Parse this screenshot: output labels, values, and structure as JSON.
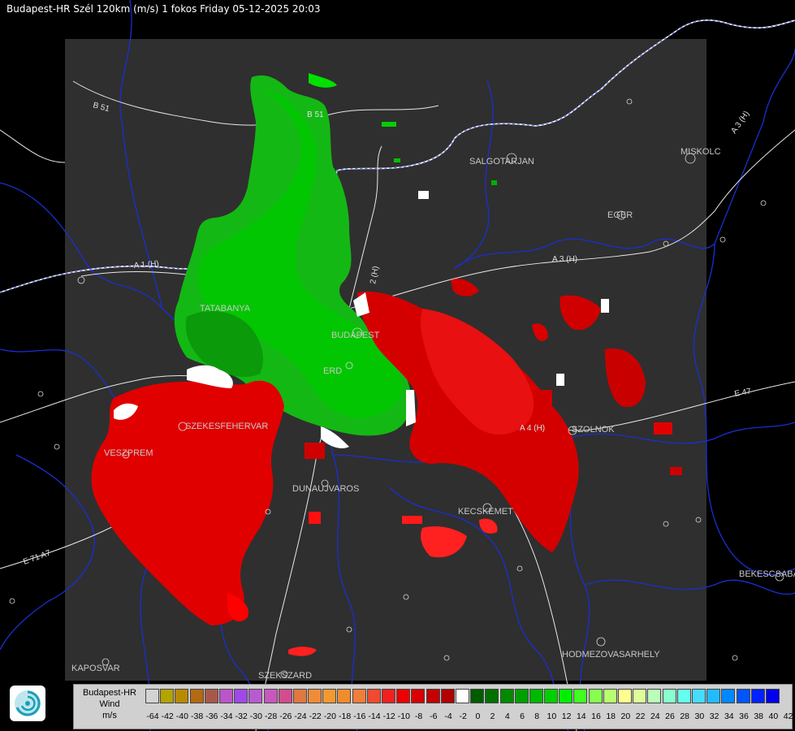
{
  "header": {
    "title": "Budapest-HR Szél 120km (m/s) 1 fokos Friday 05-12-2025 20:03"
  },
  "cities": [
    {
      "id": "salgotarjan",
      "label": "SALGOTARJAN"
    },
    {
      "id": "miskolc",
      "label": "MISKOLC"
    },
    {
      "id": "eger",
      "label": "EGER"
    },
    {
      "id": "tatabanya",
      "label": "TATABANYA"
    },
    {
      "id": "budapest",
      "label": "BUDAPEST"
    },
    {
      "id": "erd",
      "label": "ERD"
    },
    {
      "id": "szekesfehervar",
      "label": "SZEKESFEHERVAR"
    },
    {
      "id": "veszprem",
      "label": "VESZPREM"
    },
    {
      "id": "dunaujvaros",
      "label": "DUNAUJVAROS"
    },
    {
      "id": "kecskemet",
      "label": "KECSKEMET"
    },
    {
      "id": "szolnok",
      "label": "SZOLNOK"
    },
    {
      "id": "bekescsaba",
      "label": "BEKESCSABA"
    },
    {
      "id": "hodmezovasarhely",
      "label": "HODMEZOVASARHELY"
    },
    {
      "id": "kaposvar",
      "label": "KAPOSVAR"
    },
    {
      "id": "szekszard",
      "label": "SZEKSZARD"
    }
  ],
  "roads": [
    {
      "id": "b51-top",
      "label": "B 51"
    },
    {
      "id": "b51-mid",
      "label": "B 51"
    },
    {
      "id": "a1",
      "label": "A 1 (H)"
    },
    {
      "id": "a2",
      "label": "2 (H)"
    },
    {
      "id": "a3",
      "label": "A 3 (H)"
    },
    {
      "id": "a3-ne",
      "label": "A 3 (H)"
    },
    {
      "id": "a4",
      "label": "A 4 (H)"
    },
    {
      "id": "e71",
      "label": "E 71 A7"
    },
    {
      "id": "e47",
      "label": "E 47"
    }
  ],
  "legend": {
    "title_lines": [
      "Budapest-HR",
      "Wind",
      "m/s"
    ],
    "ticks": [
      "-64",
      "-42",
      "-40",
      "-38",
      "-36",
      "-34",
      "-32",
      "-30",
      "-28",
      "-26",
      "-24",
      "-22",
      "-20",
      "-18",
      "-16",
      "-14",
      "-12",
      "-10",
      "-8",
      "-6",
      "-4",
      "-2",
      "0",
      "2",
      "4",
      "6",
      "8",
      "10",
      "12",
      "14",
      "16",
      "18",
      "20",
      "22",
      "24",
      "26",
      "28",
      "30",
      "32",
      "34",
      "36",
      "38",
      "40",
      "42"
    ],
    "colors": [
      "#d3d3d3",
      "#b3a400",
      "#b88a00",
      "#b56a12",
      "#a8584a",
      "#bb55c8",
      "#a048e8",
      "#b85ad0",
      "#c658be",
      "#d24c8e",
      "#e07840",
      "#f08c38",
      "#f49830",
      "#f08c30",
      "#f07e38",
      "#f04a30",
      "#f22020",
      "#ee0000",
      "#d80000",
      "#c40000",
      "#b00000",
      "#ffffff",
      "#005c00",
      "#007000",
      "#008a00",
      "#00a000",
      "#00b800",
      "#00d000",
      "#00ee00",
      "#40ff20",
      "#88ff50",
      "#b8ff70",
      "#ffff90",
      "#ddff99",
      "#b8ffb8",
      "#88ffcc",
      "#66ffee",
      "#44ddff",
      "#22bbff",
      "#0088ff",
      "#0055ff",
      "#0022ff",
      "#0000ee"
    ]
  },
  "logo": {
    "icon": "met-service-swirl-icon"
  }
}
